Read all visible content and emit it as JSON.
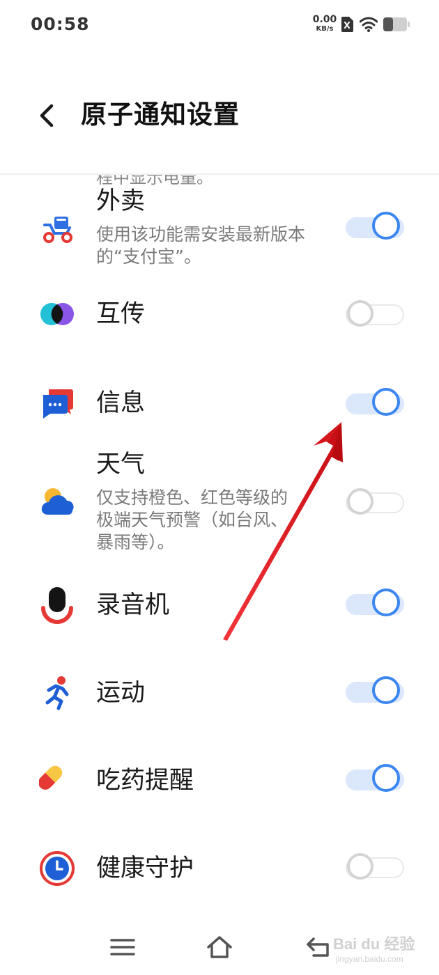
{
  "status_bar": {
    "time": "00:58",
    "net_speed_value": "0.00",
    "net_speed_unit": "KB/s",
    "icons": [
      "sim-blocked-icon",
      "wifi-icon",
      "battery-icon"
    ]
  },
  "header": {
    "back_icon": "chevron-left-icon",
    "title": "原子通知设置"
  },
  "list": {
    "clipped_text": "程中显示电量。",
    "items": [
      {
        "id": "takeout",
        "title": "外卖",
        "description": "使用该功能需安装最新版本的“支付宝”。",
        "enabled": true,
        "icon": "scooter-icon"
      },
      {
        "id": "transfer",
        "title": "互传",
        "description": "",
        "enabled": false,
        "icon": "share-circles-icon"
      },
      {
        "id": "messages",
        "title": "信息",
        "description": "",
        "enabled": true,
        "icon": "message-bubble-icon"
      },
      {
        "id": "weather",
        "title": "天气",
        "description": "仅支持橙色、红色等级的极端天气预警（如台风、暴雨等）。",
        "enabled": false,
        "icon": "weather-icon"
      },
      {
        "id": "recorder",
        "title": "录音机",
        "description": "",
        "enabled": true,
        "icon": "microphone-icon"
      },
      {
        "id": "sport",
        "title": "运动",
        "description": "",
        "enabled": true,
        "icon": "running-icon"
      },
      {
        "id": "medicine",
        "title": "吃药提醒",
        "description": "",
        "enabled": true,
        "icon": "pill-icon"
      },
      {
        "id": "health",
        "title": "健康守护",
        "description": "",
        "enabled": false,
        "icon": "clock-icon"
      }
    ]
  },
  "nav_bar": {
    "icons": [
      "menu-icon",
      "home-icon",
      "back-icon"
    ]
  },
  "colors": {
    "accent": "#3b86f0",
    "track_on": "#dbe7fb",
    "annotation_arrow": "#e8191f"
  },
  "watermark": {
    "text": "Bai du 经验",
    "sub": "jingyan.baidu.com"
  }
}
